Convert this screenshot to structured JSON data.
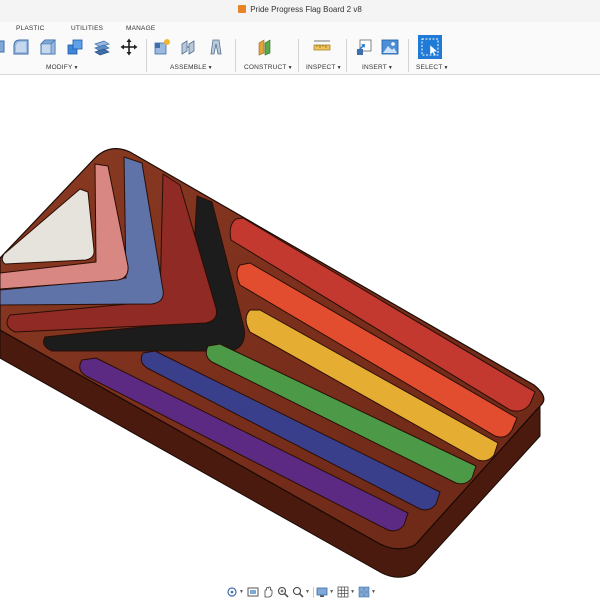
{
  "window": {
    "title": "Pride Progress Flag Board 2 v8"
  },
  "ribbon": {
    "tabs": [
      {
        "label": "PLASTIC"
      },
      {
        "label": "UTILITIES"
      },
      {
        "label": "MANAGE"
      }
    ],
    "groups": [
      {
        "label": "MODIFY"
      },
      {
        "label": "ASSEMBLE"
      },
      {
        "label": "CONSTRUCT"
      },
      {
        "label": "INSPECT"
      },
      {
        "label": "INSERT"
      },
      {
        "label": "SELECT"
      }
    ],
    "tools": [
      {
        "icon": "press-pull-icon"
      },
      {
        "icon": "fillet-icon"
      },
      {
        "icon": "chamfer-icon"
      },
      {
        "icon": "shell-icon"
      },
      {
        "icon": "combine-icon"
      },
      {
        "icon": "move-icon"
      },
      {
        "icon": "new-component-icon"
      },
      {
        "icon": "joint-icon"
      },
      {
        "icon": "as-built-joint-icon"
      },
      {
        "icon": "offset-plane-icon"
      },
      {
        "icon": "measure-icon"
      },
      {
        "icon": "insert-derive-icon"
      },
      {
        "icon": "insert-canvas-icon"
      },
      {
        "icon": "select-icon"
      }
    ],
    "accent": "#1f7bd6"
  },
  "model": {
    "wood": "#7a2f1c",
    "wood_dark": "#4a1a0e",
    "chevron_colors": [
      "#e6e2dc",
      "#d98783",
      "#5f73a8",
      "#8f2a25",
      "#1c1c1c"
    ],
    "stripe_colors": [
      "#c4392f",
      "#e34d2f",
      "#e6ad33",
      "#4c9a47",
      "#3a3f8c",
      "#5c2a82"
    ]
  },
  "navbar": {
    "items": [
      {
        "icon": "orbit-icon"
      },
      {
        "icon": "look-at-icon"
      },
      {
        "icon": "pan-icon"
      },
      {
        "icon": "zoom-icon"
      },
      {
        "icon": "fit-icon"
      },
      {
        "icon": "display-settings-icon"
      },
      {
        "icon": "grid-settings-icon"
      },
      {
        "icon": "viewports-icon"
      }
    ]
  }
}
